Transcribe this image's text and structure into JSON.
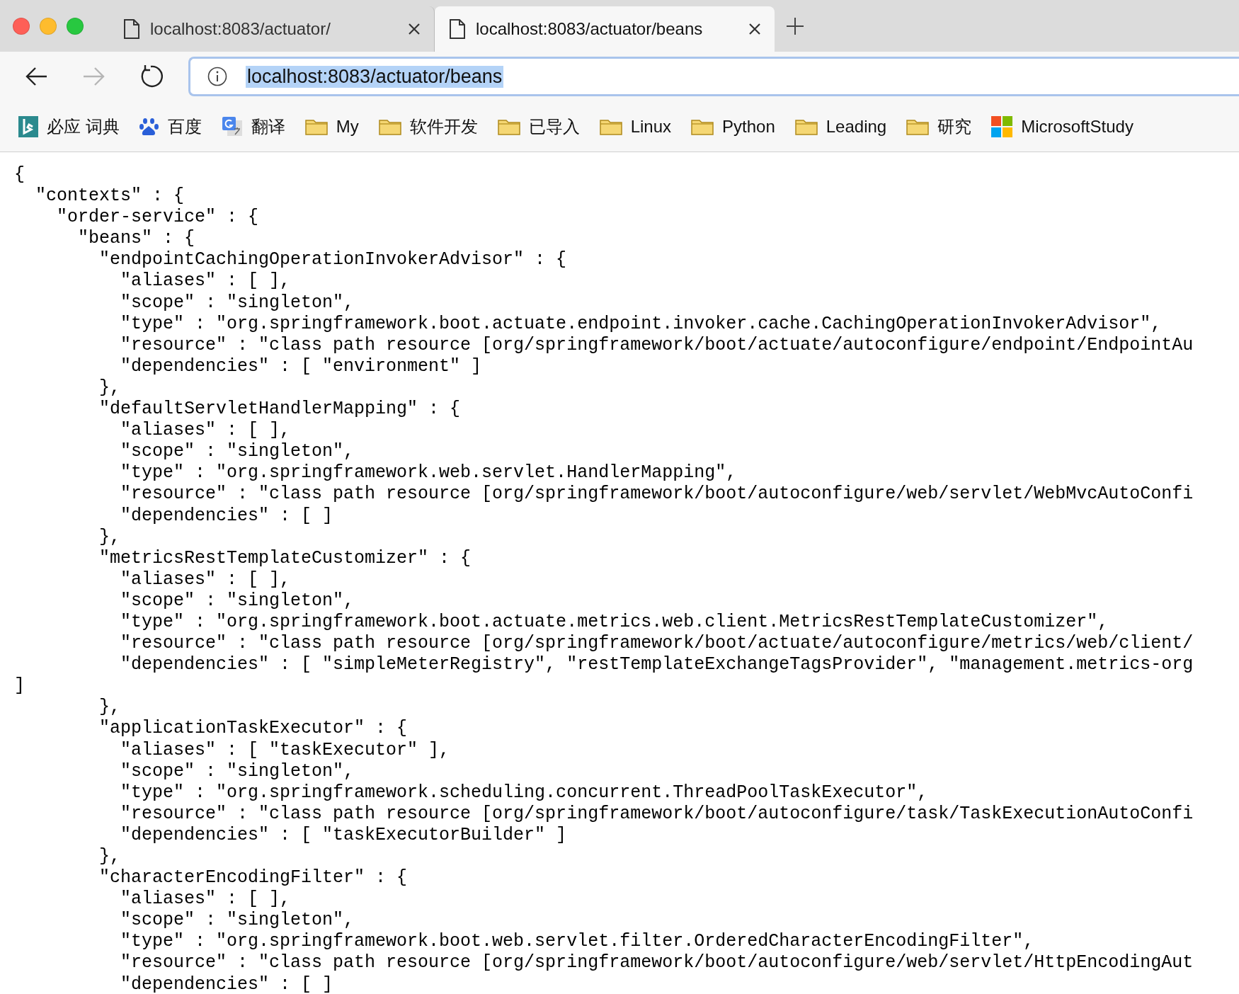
{
  "tabs": [
    {
      "title": "localhost:8083/actuator/",
      "selected": false
    },
    {
      "title": "localhost:8083/actuator/beans",
      "selected": true
    }
  ],
  "nav": {
    "back_disabled": false,
    "forward_disabled": true
  },
  "address": {
    "value": "localhost:8083/actuator/beans",
    "selected": true
  },
  "bookmarks": [
    {
      "kind": "bing",
      "label": "必应 词典"
    },
    {
      "kind": "baidu",
      "label": "百度"
    },
    {
      "kind": "translate",
      "label": "翻译"
    },
    {
      "kind": "folder",
      "label": "My"
    },
    {
      "kind": "folder",
      "label": "软件开发"
    },
    {
      "kind": "folder",
      "label": "已导入"
    },
    {
      "kind": "folder",
      "label": "Linux"
    },
    {
      "kind": "folder",
      "label": "Python"
    },
    {
      "kind": "folder",
      "label": "Leading"
    },
    {
      "kind": "folder",
      "label": "研究"
    },
    {
      "kind": "microsoft",
      "label": "MicrosoftStudy"
    }
  ],
  "json_lines": [
    "{",
    "  \"contexts\" : {",
    "    \"order-service\" : {",
    "      \"beans\" : {",
    "        \"endpointCachingOperationInvokerAdvisor\" : {",
    "          \"aliases\" : [ ],",
    "          \"scope\" : \"singleton\",",
    "          \"type\" : \"org.springframework.boot.actuate.endpoint.invoker.cache.CachingOperationInvokerAdvisor\",",
    "          \"resource\" : \"class path resource [org/springframework/boot/actuate/autoconfigure/endpoint/EndpointAu",
    "          \"dependencies\" : [ \"environment\" ]",
    "        },",
    "        \"defaultServletHandlerMapping\" : {",
    "          \"aliases\" : [ ],",
    "          \"scope\" : \"singleton\",",
    "          \"type\" : \"org.springframework.web.servlet.HandlerMapping\",",
    "          \"resource\" : \"class path resource [org/springframework/boot/autoconfigure/web/servlet/WebMvcAutoConfi",
    "          \"dependencies\" : [ ]",
    "        },",
    "        \"metricsRestTemplateCustomizer\" : {",
    "          \"aliases\" : [ ],",
    "          \"scope\" : \"singleton\",",
    "          \"type\" : \"org.springframework.boot.actuate.metrics.web.client.MetricsRestTemplateCustomizer\",",
    "          \"resource\" : \"class path resource [org/springframework/boot/actuate/autoconfigure/metrics/web/client/",
    "          \"dependencies\" : [ \"simpleMeterRegistry\", \"restTemplateExchangeTagsProvider\", \"management.metrics-org",
    "]",
    "        },",
    "        \"applicationTaskExecutor\" : {",
    "          \"aliases\" : [ \"taskExecutor\" ],",
    "          \"scope\" : \"singleton\",",
    "          \"type\" : \"org.springframework.scheduling.concurrent.ThreadPoolTaskExecutor\",",
    "          \"resource\" : \"class path resource [org/springframework/boot/autoconfigure/task/TaskExecutionAutoConfi",
    "          \"dependencies\" : [ \"taskExecutorBuilder\" ]",
    "        },",
    "        \"characterEncodingFilter\" : {",
    "          \"aliases\" : [ ],",
    "          \"scope\" : \"singleton\",",
    "          \"type\" : \"org.springframework.boot.web.servlet.filter.OrderedCharacterEncodingFilter\",",
    "          \"resource\" : \"class path resource [org/springframework/boot/autoconfigure/web/servlet/HttpEncodingAut",
    "          \"dependencies\" : [ ]"
  ]
}
